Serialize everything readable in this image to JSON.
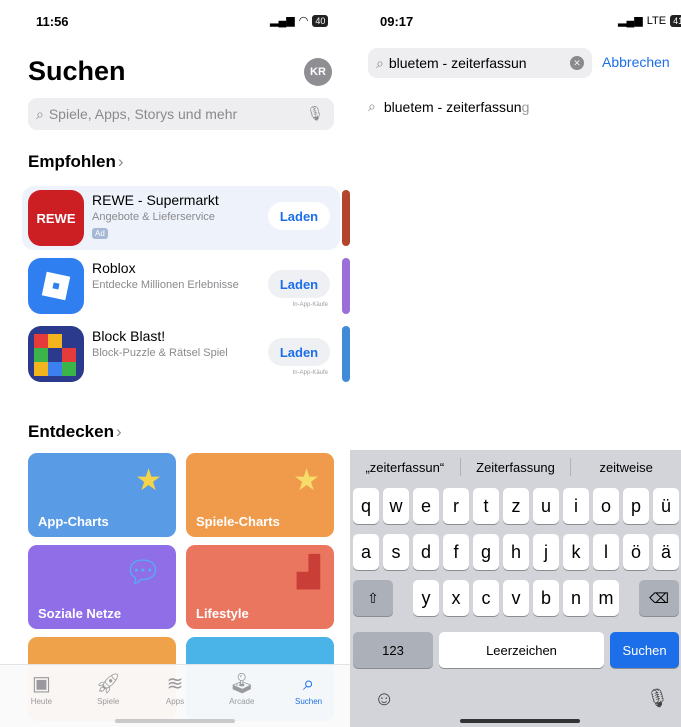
{
  "left": {
    "status_time": "11:56",
    "status_battery": "40",
    "title": "Suchen",
    "avatar_initials": "KR",
    "search_placeholder": "Spiele, Apps, Storys und mehr",
    "recommended_title": "Empfohlen",
    "apps": [
      {
        "name": "REWE - Supermarkt",
        "subtitle": "Angebote & Lieferservice",
        "badge": "Ad",
        "button": "Laden",
        "note": "",
        "icon_text": "REWE"
      },
      {
        "name": "Roblox",
        "subtitle": "Entdecke Millionen Erlebnisse",
        "badge": "",
        "button": "Laden",
        "note": "In-App-Käufe",
        "icon_text": ""
      },
      {
        "name": "Block Blast!",
        "subtitle": "Block-Puzzle & Rätsel Spiel",
        "badge": "",
        "button": "Laden",
        "note": "In-App-Käufe",
        "icon_text": ""
      }
    ],
    "discover_title": "Entdecken",
    "tiles": [
      {
        "label": "App-Charts",
        "color": "#5a9be6"
      },
      {
        "label": "Spiele-Charts",
        "color": "#f09a4b"
      },
      {
        "label": "Soziale Netze",
        "color": "#8f6ee8"
      },
      {
        "label": "Lifestyle",
        "color": "#ea7660"
      },
      {
        "label": "",
        "color": "#f0a24a"
      },
      {
        "label": "",
        "color": "#4ab3e8"
      }
    ],
    "tabs": [
      "Heute",
      "Spiele",
      "Apps",
      "Arcade",
      "Suchen"
    ]
  },
  "right": {
    "status_time": "09:17",
    "status_network": "LTE",
    "status_battery": "41",
    "search_value": "bluetem - zeiterfassun",
    "cancel_label": "Abbrechen",
    "suggestion_bold": "bluetem - zeiterfassun",
    "suggestion_rest": "g",
    "predictions": [
      "„zeiterfassun“",
      "Zeiterfassung",
      "zeitweise"
    ],
    "row1": [
      "q",
      "w",
      "e",
      "r",
      "t",
      "z",
      "u",
      "i",
      "o",
      "p",
      "ü"
    ],
    "row2": [
      "a",
      "s",
      "d",
      "f",
      "g",
      "h",
      "j",
      "k",
      "l",
      "ö",
      "ä"
    ],
    "row3": [
      "y",
      "x",
      "c",
      "v",
      "b",
      "n",
      "m"
    ],
    "key_numbers": "123",
    "key_space": "Leerzeichen",
    "key_search": "Suchen"
  },
  "colors": {
    "accent": "#1c6fe8",
    "keyboard_bg": "#d2d4d9"
  }
}
